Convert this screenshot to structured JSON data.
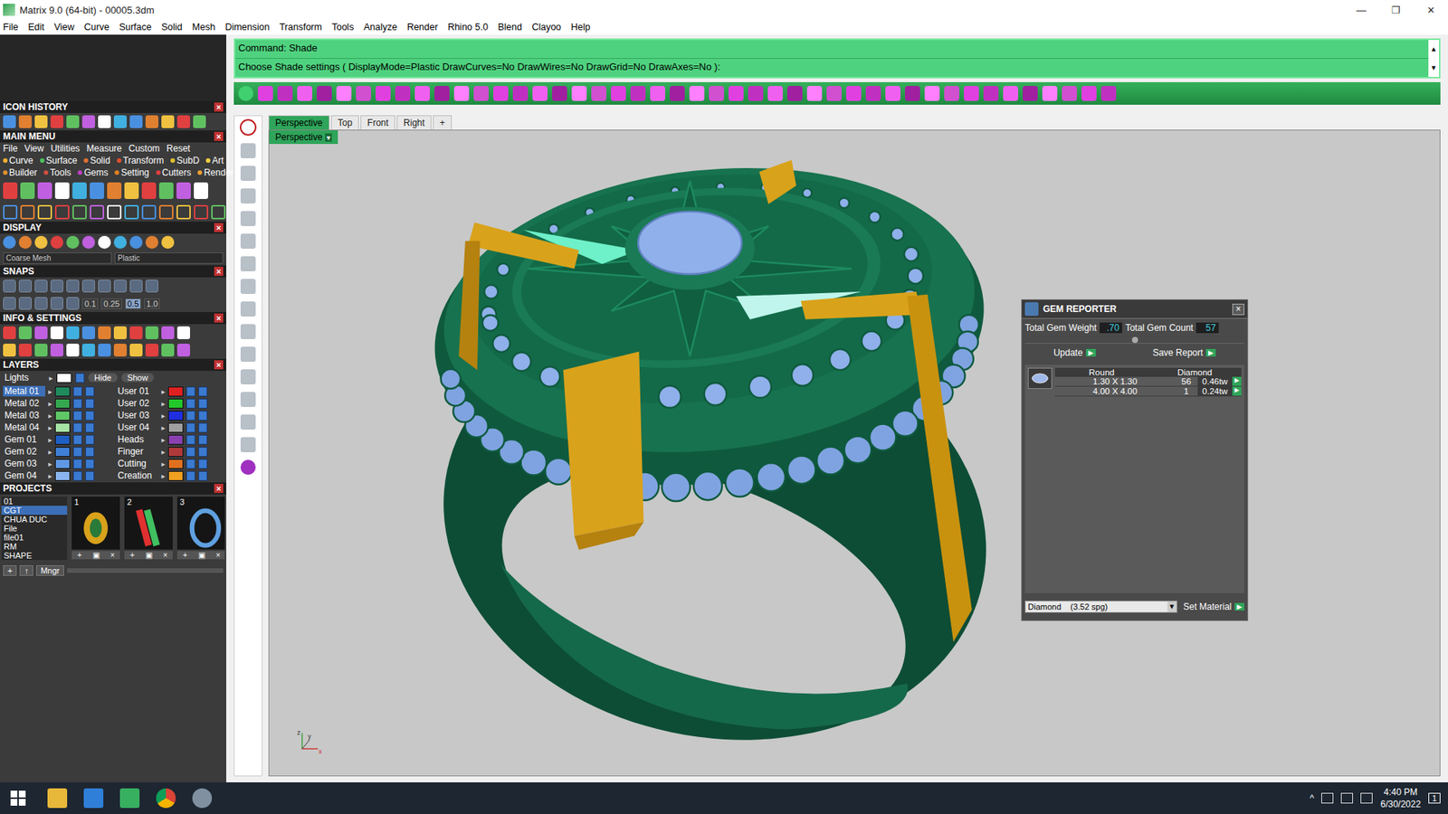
{
  "window": {
    "title": "Matrix 9.0 (64-bit) - 00005.3dm",
    "controls": [
      "—",
      "❐",
      "✕"
    ]
  },
  "menu": [
    "File",
    "Edit",
    "View",
    "Curve",
    "Surface",
    "Solid",
    "Mesh",
    "Dimension",
    "Transform",
    "Tools",
    "Analyze",
    "Render",
    "Rhino 5.0",
    "Blend",
    "Clayoo",
    "Help"
  ],
  "command": {
    "line1": "Command: Shade",
    "line2": "Choose Shade settings ( DisplayMode=Plastic  DrawCurves=No  DrawWires=No  DrawGrid=No  DrawAxes=No ):",
    "scroll": [
      "▲",
      "▼"
    ]
  },
  "sidebar": {
    "close": "×",
    "icon_history": {
      "title": "ICON HISTORY"
    },
    "main_menu": {
      "title": "MAIN MENU",
      "items": [
        "File",
        "View",
        "Utilities",
        "Measure",
        "Custom",
        "Reset"
      ],
      "categories": [
        [
          {
            "label": "Curve",
            "color": "#f0b030"
          },
          {
            "label": "Surface",
            "color": "#4cc060"
          },
          {
            "label": "Solid",
            "color": "#e07030"
          },
          {
            "label": "Transform",
            "color": "#e05030"
          },
          {
            "label": "SubD",
            "color": "#e0c030"
          },
          {
            "label": "Art",
            "color": "#f0d040"
          }
        ],
        [
          {
            "label": "Builder",
            "color": "#e09030"
          },
          {
            "label": "Tools",
            "color": "#d05040"
          },
          {
            "label": "Gems",
            "color": "#c040c0"
          },
          {
            "label": "Setting",
            "color": "#e08020"
          },
          {
            "label": "Cutters",
            "color": "#e04040"
          },
          {
            "label": "Render",
            "color": "#f0a030"
          }
        ]
      ]
    },
    "display": {
      "title": "DISPLAY",
      "dropdowns": [
        "Coarse Mesh",
        "Plastic"
      ]
    },
    "snaps": {
      "title": "SNAPS",
      "values": [
        {
          "label": "0.1",
          "selected": false
        },
        {
          "label": "0.25",
          "selected": false
        },
        {
          "label": "0.5",
          "selected": true
        },
        {
          "label": "1.0",
          "selected": false
        }
      ]
    },
    "info": {
      "title": "INFO & SETTINGS"
    },
    "layers": {
      "title": "LAYERS",
      "lights": "Lights",
      "hide": "Hide",
      "show": "Show",
      "arrow": "▸",
      "rows": [
        [
          {
            "name": "Metal 01",
            "color": "#1f8a5c",
            "selected": true
          },
          {
            "name": "User 01",
            "color": "#e02020",
            "selected": false
          }
        ],
        [
          {
            "name": "Metal 02",
            "color": "#35a84f",
            "selected": false
          },
          {
            "name": "User 02",
            "color": "#22c82a",
            "selected": false
          }
        ],
        [
          {
            "name": "Metal 03",
            "color": "#5fc765",
            "selected": false
          },
          {
            "name": "User 03",
            "color": "#1f2fe0",
            "selected": false
          }
        ],
        [
          {
            "name": "Metal 04",
            "color": "#a7e3a5",
            "selected": false
          },
          {
            "name": "User 04",
            "color": "#a0a0a0",
            "selected": false
          }
        ],
        [
          {
            "name": "Gem 01",
            "color": "#1f5fc4",
            "selected": false
          },
          {
            "name": "Heads",
            "color": "#8a3fb0",
            "selected": false
          }
        ],
        [
          {
            "name": "Gem 02",
            "color": "#3f7fd6",
            "selected": false
          },
          {
            "name": "Finger",
            "color": "#b03a3a",
            "selected": false
          }
        ],
        [
          {
            "name": "Gem 03",
            "color": "#5f97e4",
            "selected": false
          },
          {
            "name": "Cutting",
            "color": "#e07020",
            "selected": false
          }
        ],
        [
          {
            "name": "Gem 04",
            "color": "#8ab4f0",
            "selected": false
          },
          {
            "name": "Creation",
            "color": "#f0a020",
            "selected": false
          }
        ]
      ]
    },
    "projects": {
      "title": "PROJECTS",
      "items": [
        {
          "label": "01",
          "selected": false
        },
        {
          "label": "CGT",
          "selected": true
        },
        {
          "label": "CHUA DUC",
          "selected": false
        },
        {
          "label": "File",
          "selected": false
        },
        {
          "label": "file01",
          "selected": false
        },
        {
          "label": "RM",
          "selected": false
        },
        {
          "label": "SHAPE",
          "selected": false
        }
      ],
      "thumbnails": [
        "1",
        "2",
        "3"
      ],
      "thumb_controls": [
        "+",
        "▣",
        "×"
      ],
      "buttons": [
        "+",
        "↑",
        "Mngr"
      ]
    }
  },
  "viewport": {
    "tabs": [
      {
        "label": "Perspective",
        "selected": true
      },
      {
        "label": "Top",
        "selected": false
      },
      {
        "label": "Front",
        "selected": false
      },
      {
        "label": "Right",
        "selected": false
      },
      {
        "label": "+",
        "selected": false
      }
    ],
    "label": "Perspective",
    "label_arrow": "▾",
    "axes": [
      "z",
      "y",
      "x"
    ]
  },
  "gem_reporter": {
    "title": "GEM REPORTER",
    "close": "×",
    "weight_label": "Total Gem Weight",
    "weight": ".70",
    "count_label": "Total Gem Count",
    "count": "57",
    "buttons": [
      "Update",
      "Save Report"
    ],
    "play": "▶",
    "columns": [
      "Round",
      "Diamond"
    ],
    "rows": [
      {
        "size": "1.30 X 1.30",
        "count": "56",
        "weight": "0.46tw"
      },
      {
        "size": "4.00 X 4.00",
        "count": "1",
        "weight": "0.24tw"
      }
    ],
    "material": "Diamond    (3.52 spg)",
    "dropdown_arrow": "▾",
    "set_material": "Set Material"
  },
  "taskbar": {
    "time": "4:40 PM",
    "date": "6/30/2022",
    "tray_chevron": "^",
    "notification": "1"
  }
}
